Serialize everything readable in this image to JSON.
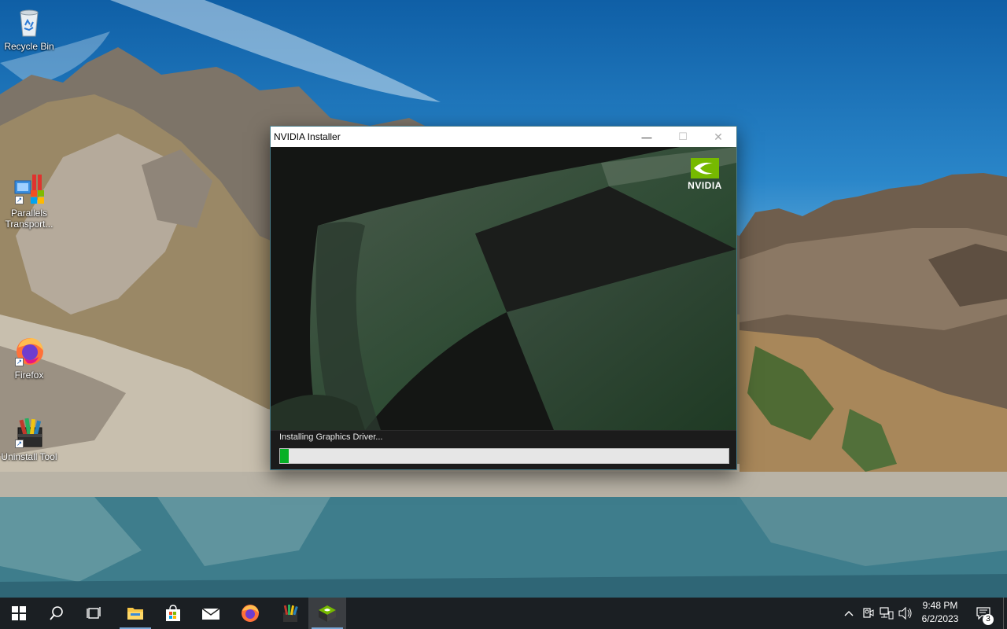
{
  "desktop": {
    "icons": [
      {
        "label": "Recycle Bin",
        "icon": "recycle-bin-icon"
      },
      {
        "label": "Parallels Transport...",
        "icon": "parallels-transporter-icon"
      },
      {
        "label": "Firefox",
        "icon": "firefox-icon"
      },
      {
        "label": "Uninstall Tool",
        "icon": "uninstall-tool-icon"
      }
    ]
  },
  "installer": {
    "title": "NVIDIA Installer",
    "controls": {
      "minimize": "—",
      "maximize": "☐",
      "close": "✕"
    },
    "brand": "NVIDIA",
    "status": "Installing Graphics Driver...",
    "progress": 0.02,
    "progress_color": "#06b025",
    "brand_color": "#76b900"
  },
  "taskbar": {
    "pinned": [
      {
        "name": "start-button",
        "icon": "windows-logo-icon"
      },
      {
        "name": "search-button",
        "icon": "search-icon"
      },
      {
        "name": "task-view-button",
        "icon": "task-view-icon"
      },
      {
        "name": "file-explorer-button",
        "icon": "folder-icon",
        "active": true
      },
      {
        "name": "microsoft-store-button",
        "icon": "store-icon"
      },
      {
        "name": "mail-button",
        "icon": "mail-icon"
      },
      {
        "name": "firefox-button",
        "icon": "firefox-icon"
      },
      {
        "name": "uninstall-tool-button",
        "icon": "uninstall-tool-icon"
      },
      {
        "name": "nvidia-installer-button",
        "icon": "nvidia-installer-icon",
        "active": true,
        "focused": true
      }
    ],
    "tray": {
      "icons": [
        "chevron-up-icon",
        "meet-now-icon",
        "network-icon",
        "volume-icon"
      ],
      "time": "9:48 PM",
      "date": "6/2/2023",
      "notifications": "3"
    }
  }
}
